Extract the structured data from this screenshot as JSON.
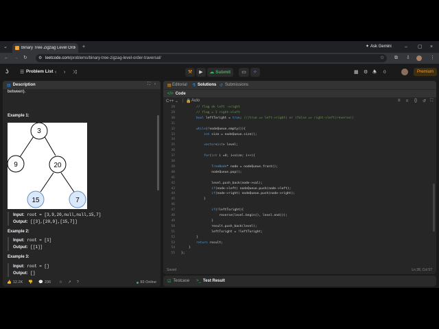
{
  "browser": {
    "tab_title": "Binary Tree Zigzag Level Order",
    "url_host": "leetcode.com",
    "url_path": "/problems/binary-tree-zigzag-level-order-traversal/",
    "ask_gemini": "Ask Gemini"
  },
  "nav": {
    "problem_list": "Problem List",
    "submit": "Submit",
    "premium": "Premium",
    "badge_count": "0"
  },
  "left": {
    "tab": "Description",
    "intro": "between).",
    "ex1_title": "Example 1:",
    "ex1_input_k": "Input:",
    "ex1_input": "root = [3,9,20,null,null,15,7]",
    "ex1_output_k": "Output:",
    "ex1_output": "[[3],[20,9],[15,7]]",
    "ex2_title": "Example 2:",
    "ex2_input_k": "Input:",
    "ex2_input": "root = [1]",
    "ex2_output_k": "Output:",
    "ex2_output": "[[1]]",
    "ex3_title": "Example 3:",
    "ex3_input_k": "Input:",
    "ex3_input": "root = []",
    "ex3_output_k": "Output:",
    "ex3_output": "[]",
    "tree": {
      "nodes": [
        "3",
        "9",
        "20",
        "15",
        "7"
      ]
    },
    "likes": "12.2K",
    "comments": "236",
    "online": "83 Online"
  },
  "editor": {
    "tab_editorial": "Editorial",
    "tab_solutions": "Solutions",
    "tab_submissions": "Submissions",
    "code_title": "Code",
    "lang": "C++",
    "mode": "Auto",
    "saved": "Saved",
    "cursor": "Ln 28, Col 57",
    "lines": [
      {
        "n": "28",
        "t": "        // flag ok left ->right"
      },
      {
        "n": "29",
        "t": "        // flag = 1 right->left"
      },
      {
        "n": "30",
        "t": "        bool leftToright = true; //(true => left->right) or (false => right->left(reverse))"
      },
      {
        "n": "31",
        "t": ""
      },
      {
        "n": "32",
        "t": "        while(!nodeQueue.empty()){"
      },
      {
        "n": "33",
        "t": "            int size = nodeQueue.size();"
      },
      {
        "n": "34",
        "t": ""
      },
      {
        "n": "35",
        "t": "            vector<int> level;"
      },
      {
        "n": "36",
        "t": ""
      },
      {
        "n": "37",
        "t": "            for(int i =0; i<size; i++){"
      },
      {
        "n": "38",
        "t": ""
      },
      {
        "n": "39",
        "t": "                TreeNode* node = nodeQueue.front();"
      },
      {
        "n": "40",
        "t": "                nodeQueue.pop();"
      },
      {
        "n": "41",
        "t": ""
      },
      {
        "n": "42",
        "t": "                level.push_back(node->val);"
      },
      {
        "n": "43",
        "t": "                if(node->left) nodeQueue.push(node->left);"
      },
      {
        "n": "44",
        "t": "                if(node->right) nodeQueue.push(node->right);"
      },
      {
        "n": "45",
        "t": "            }"
      },
      {
        "n": "46",
        "t": ""
      },
      {
        "n": "47",
        "t": "                if(!leftToright){"
      },
      {
        "n": "48",
        "t": "                    reverse(level.begin(), level.end());"
      },
      {
        "n": "49",
        "t": "                }"
      },
      {
        "n": "50",
        "t": "                result.push_back(level);"
      },
      {
        "n": "51",
        "t": "                leftToright = !leftToright;"
      },
      {
        "n": "52",
        "t": "        }"
      },
      {
        "n": "53",
        "t": "        return result;"
      },
      {
        "n": "54",
        "t": "    }"
      },
      {
        "n": "55",
        "t": "};"
      }
    ]
  },
  "bottom": {
    "testcase": "Testcase",
    "test_result": "Test Result"
  },
  "colors": {
    "accent": "#ffa116",
    "submit": "#2cbb5d",
    "node_blue": "#dae8fc",
    "node_stroke": "#6c8ebf"
  }
}
